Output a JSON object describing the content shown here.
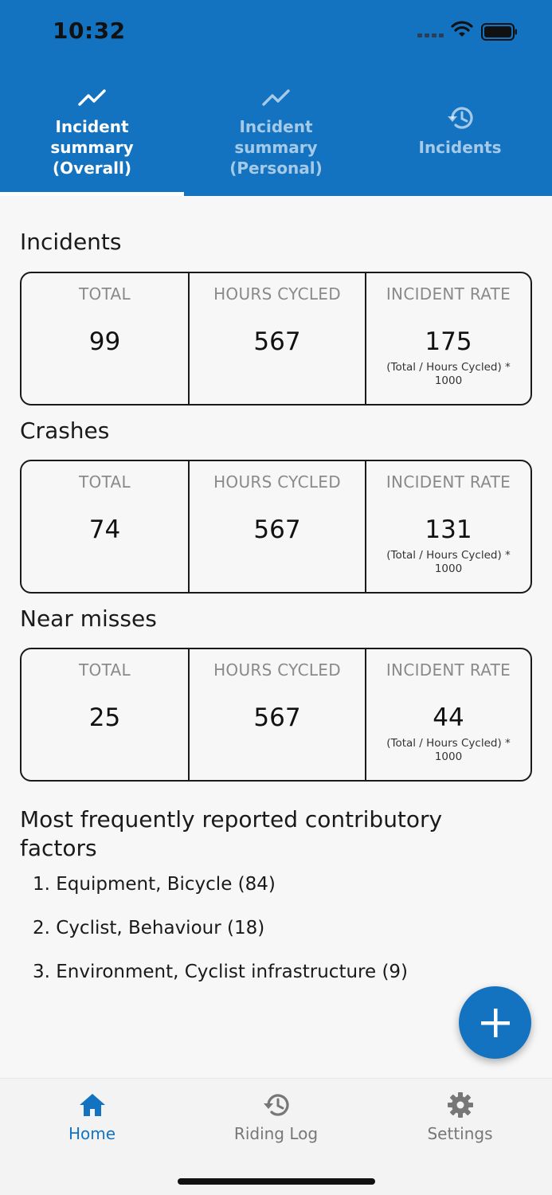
{
  "status_bar": {
    "time": "10:32"
  },
  "tabs": [
    {
      "label": "Incident\nsummary\n(Overall)",
      "icon": "trending-up-icon",
      "active": true
    },
    {
      "label": "Incident\nsummary\n(Personal)",
      "icon": "trending-up-icon",
      "active": false
    },
    {
      "label": "Incidents",
      "icon": "history-icon",
      "active": false
    }
  ],
  "sections": {
    "incidents": {
      "title": "Incidents",
      "total_label": "TOTAL",
      "total": "99",
      "hours_label": "HOURS CYCLED",
      "hours": "567",
      "rate_label": "INCIDENT RATE",
      "rate": "175",
      "rate_note": "(Total / Hours Cycled) * 1000"
    },
    "crashes": {
      "title": "Crashes",
      "total_label": "TOTAL",
      "total": "74",
      "hours_label": "HOURS CYCLED",
      "hours": "567",
      "rate_label": "INCIDENT RATE",
      "rate": "131",
      "rate_note": "(Total / Hours Cycled) * 1000"
    },
    "near_misses": {
      "title": "Near misses",
      "total_label": "TOTAL",
      "total": "25",
      "hours_label": "HOURS CYCLED",
      "hours": "567",
      "rate_label": "INCIDENT RATE",
      "rate": "44",
      "rate_note": "(Total / Hours Cycled) * 1000"
    }
  },
  "factors": {
    "title": "Most frequently reported contributory factors",
    "items": [
      "1. Equipment, Bicycle (84)",
      "2. Cyclist, Behaviour (18)",
      "3. Environment, Cyclist infrastructure (9)"
    ]
  },
  "fab": {
    "icon": "plus-icon"
  },
  "bottom_nav": [
    {
      "label": "Home",
      "icon": "home-icon",
      "active": true
    },
    {
      "label": "Riding Log",
      "icon": "history-icon",
      "active": false
    },
    {
      "label": "Settings",
      "icon": "gear-icon",
      "active": false
    }
  ],
  "colors": {
    "primary": "#1473c0",
    "background": "#f7f7f7",
    "muted": "#8a8a8a"
  }
}
